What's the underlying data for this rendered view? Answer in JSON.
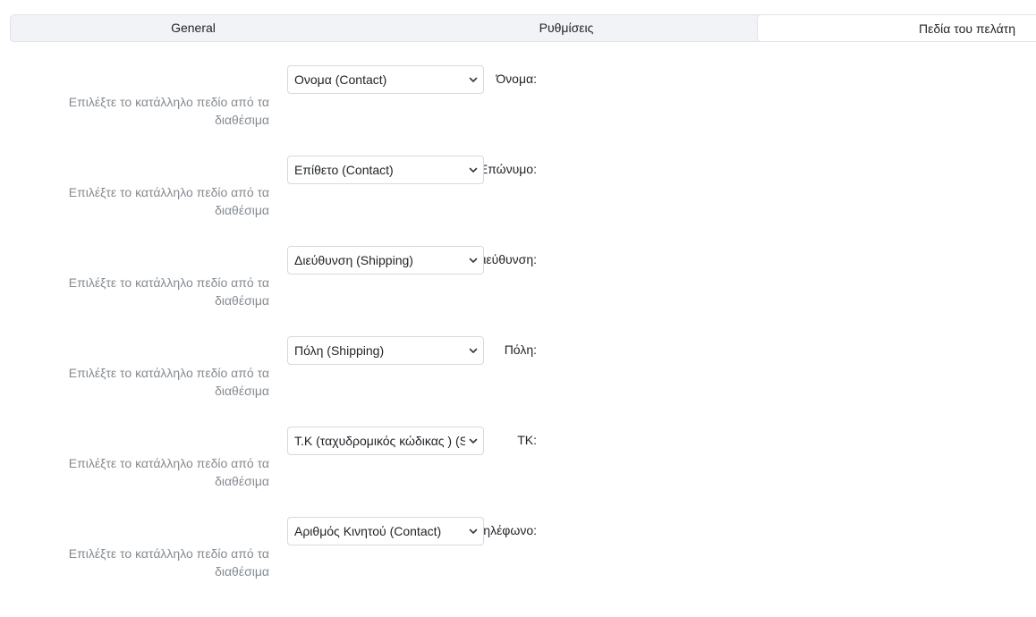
{
  "tabs": [
    {
      "label": "General",
      "active": false
    },
    {
      "label": "Ρυθμίσεις",
      "active": false
    },
    {
      "label": "Πεδία του πελάτη",
      "active": true
    }
  ],
  "fields": [
    {
      "label": "Όνομα:",
      "help": "Επιλέξτε το κατάλληλο πεδίο από τα διαθέσιμα",
      "selected": "Ονομα (Contact)"
    },
    {
      "label": "Επώνυμο:",
      "help": "Επιλέξτε το κατάλληλο πεδίο από τα διαθέσιμα",
      "selected": "Επίθετο (Contact)"
    },
    {
      "label": "Διεύθυνση:",
      "help": "Επιλέξτε το κατάλληλο πεδίο από τα διαθέσιμα",
      "selected": "Διεύθυνση (Shipping)"
    },
    {
      "label": "Πόλη:",
      "help": "Επιλέξτε το κατάλληλο πεδίο από τα διαθέσιμα",
      "selected": "Πόλη (Shipping)"
    },
    {
      "label": "ΤΚ:",
      "help": "Επιλέξτε το κατάλληλο πεδίο από τα διαθέσιμα",
      "selected": "Τ.Κ (ταχυδρομικός κώδικας ) (Shipping)"
    },
    {
      "label": "Τηλέφωνο:",
      "help": "Επιλέξτε το κατάλληλο πεδίο από τα διαθέσιμα",
      "selected": "Αριθμός Κινητού (Contact)"
    }
  ],
  "icons": {
    "select_arrow": "chevron-down-icon"
  }
}
